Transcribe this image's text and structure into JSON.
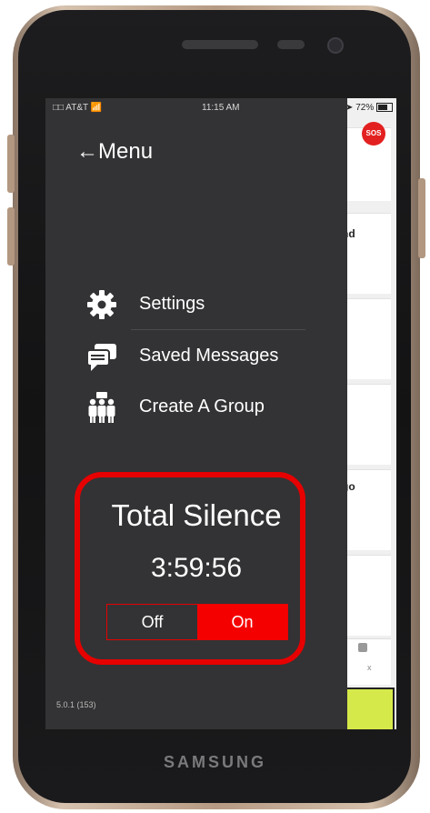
{
  "status_bar": {
    "carrier": "□□ AT&T 📶",
    "time": "11:15 AM",
    "battery": "72%"
  },
  "drawer": {
    "title": "←Menu",
    "items": [
      {
        "label": "Settings",
        "icon": "gear-icon"
      },
      {
        "label": "Saved Messages",
        "icon": "chat-bubbles-icon"
      },
      {
        "label": "Create A Group",
        "icon": "group-icon"
      }
    ],
    "silence": {
      "title": "Total Silence",
      "timer": "3:59:56",
      "off_label": "Off",
      "on_label": "On",
      "selected": "On"
    },
    "version": "5.0.1 (153)"
  },
  "background_app": {
    "sos_label": "SOS",
    "snippet_1": "nd",
    "snippet_2": "go",
    "tab_label": "x"
  },
  "device": {
    "brand": "SAMSUNG"
  },
  "colors": {
    "drawer_bg": "#333335",
    "accent_red": "#e60000",
    "text": "#ffffff"
  }
}
